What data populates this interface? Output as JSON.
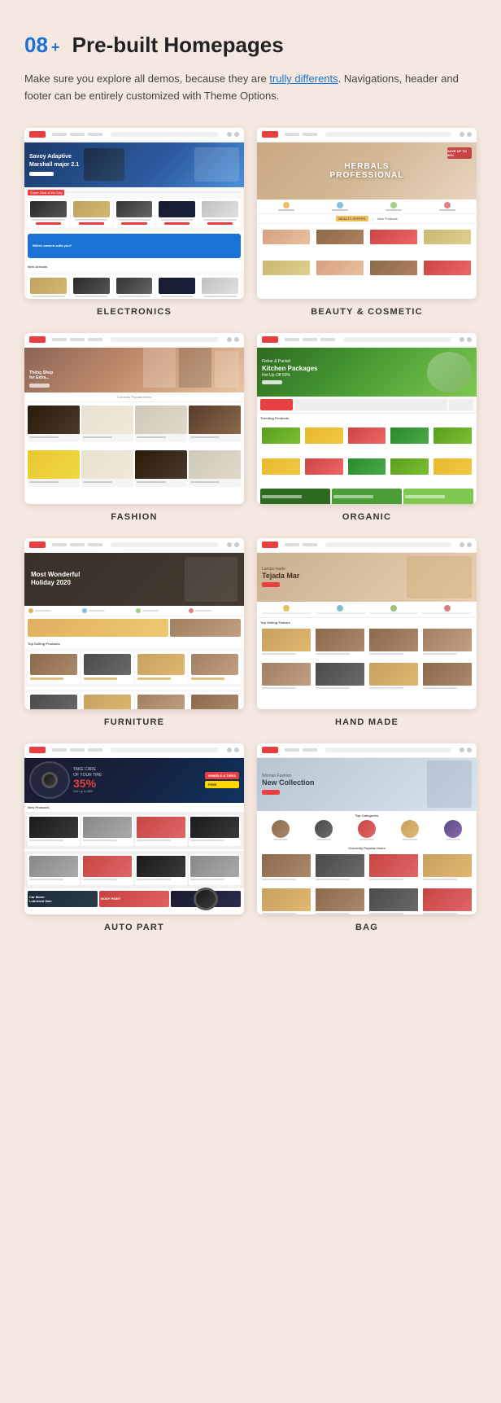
{
  "header": {
    "number": "08",
    "plus": "+",
    "title": "Pre-built Homepages"
  },
  "description": {
    "text_before": "Make sure you explore all demos, because they are ",
    "link_text": "trully differents",
    "text_after": ". Navigations, header and footer can be entirely customized with Theme Options."
  },
  "demos": [
    {
      "id": "electronics",
      "label": "ELECTRONICS"
    },
    {
      "id": "beauty",
      "label": "BEAUTY & COSMETIC"
    },
    {
      "id": "fashion",
      "label": "FASHION"
    },
    {
      "id": "organic",
      "label": "ORGANIC"
    },
    {
      "id": "furniture",
      "label": "FURNITURE"
    },
    {
      "id": "handmade",
      "label": "HAND MADE"
    },
    {
      "id": "auto",
      "label": "AUTO PART"
    },
    {
      "id": "bag",
      "label": "BAG"
    }
  ],
  "furniture_hero_text": "Most Wonderful\nHoliday 2020"
}
